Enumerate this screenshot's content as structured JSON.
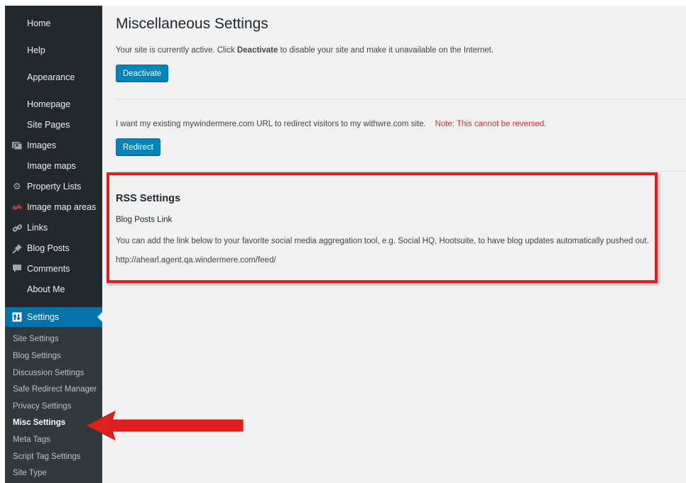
{
  "sidebar": {
    "items": [
      {
        "label": "Home",
        "icon": ""
      },
      {
        "label": "Help",
        "icon": ""
      },
      {
        "label": "Appearance",
        "icon": ""
      },
      {
        "label": "Homepage",
        "icon": ""
      },
      {
        "label": "Site Pages",
        "icon": ""
      },
      {
        "label": "Images",
        "icon": "images-icon"
      },
      {
        "label": "Image maps",
        "icon": ""
      },
      {
        "label": "Property Lists",
        "icon": "gear-icon"
      },
      {
        "label": "Image map areas",
        "icon": "map-areas-icon"
      },
      {
        "label": "Links",
        "icon": "link-icon"
      },
      {
        "label": "Blog Posts",
        "icon": "pushpin-icon"
      },
      {
        "label": "Comments",
        "icon": "comment-icon"
      },
      {
        "label": "About Me",
        "icon": ""
      },
      {
        "label": "Settings",
        "icon": "settings-icon"
      }
    ],
    "submenu": [
      "Site Settings",
      "Blog Settings",
      "Discussion Settings",
      "Safe Redirect Manager",
      "Privacy Settings",
      "Misc Settings",
      "Meta Tags",
      "Script Tag Settings",
      "Site Type"
    ],
    "active_color": "#0073aa"
  },
  "main": {
    "title": "Miscellaneous Settings",
    "status_text_1": "Your site is currently active. Click ",
    "status_text_bold": "Deactivate",
    "status_text_2": " to disable your site and make it unavailable on the Internet.",
    "deactivate_button": "Deactivate",
    "redirect_text": "I want my existing mywindermere.com URL to redirect visitors to my withwre.com site.",
    "redirect_note": "Note: This cannot be reversed.",
    "redirect_button": "Redirect",
    "rss": {
      "heading": "RSS Settings",
      "subheading": "Blog Posts Link",
      "description": "You can add the link below to your favorite social media aggregation tool, e.g. Social HQ, Hootsuite, to have blog updates automatically pushed out.",
      "feed_url": "http://ahearl.agent.qa.windermere.com/feed/"
    }
  },
  "colors": {
    "highlight": "#e0201f",
    "note": "#dc3232",
    "button": "#0085ba"
  }
}
